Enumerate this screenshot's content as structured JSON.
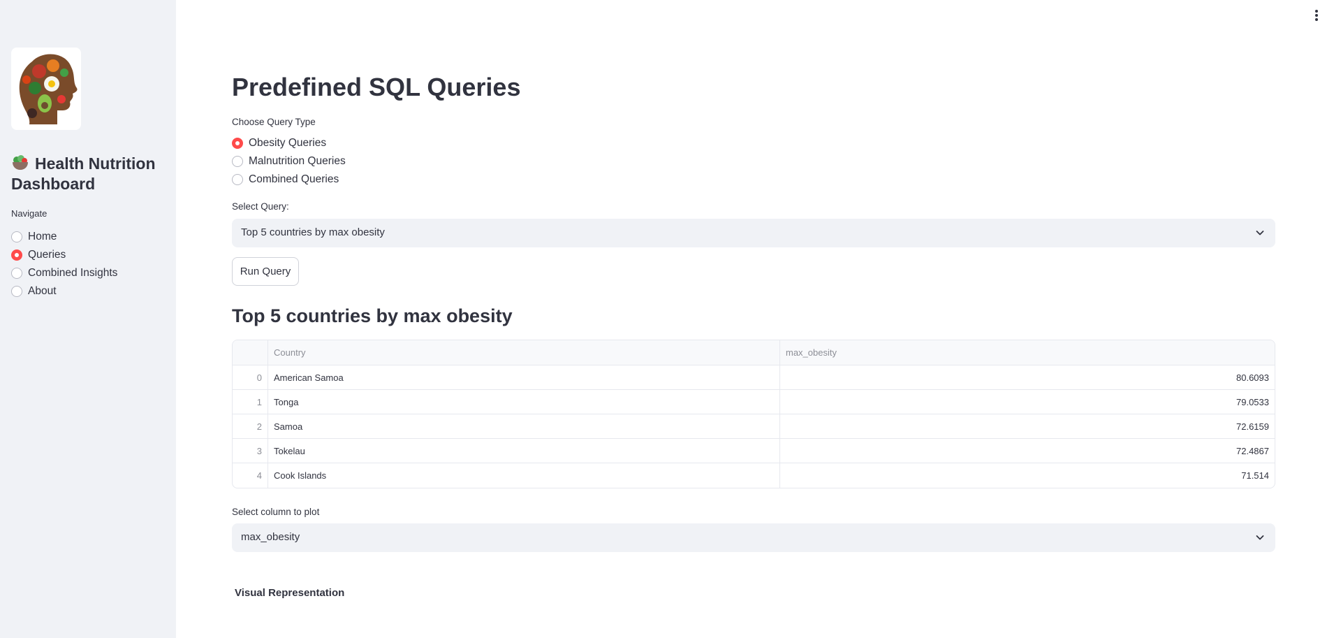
{
  "sidebar": {
    "title": "Health Nutrition Dashboard",
    "nav_label": "Navigate",
    "nav_items": [
      {
        "label": "Home",
        "selected": false
      },
      {
        "label": "Queries",
        "selected": true
      },
      {
        "label": "Combined Insights",
        "selected": false
      },
      {
        "label": "About",
        "selected": false
      }
    ]
  },
  "main": {
    "page_title": "Predefined SQL Queries",
    "query_type": {
      "label": "Choose Query Type",
      "options": [
        {
          "label": "Obesity Queries",
          "selected": true
        },
        {
          "label": "Malnutrition Queries",
          "selected": false
        },
        {
          "label": "Combined Queries",
          "selected": false
        }
      ]
    },
    "select_query": {
      "label": "Select Query:",
      "value": "Top 5 countries by max obesity"
    },
    "run_button": "Run Query",
    "result_title": "Top 5 countries by max obesity",
    "table": {
      "columns": [
        "Country",
        "max_obesity"
      ],
      "rows": [
        {
          "index": "0",
          "country": "American Samoa",
          "max_obesity": "80.6093"
        },
        {
          "index": "1",
          "country": "Tonga",
          "max_obesity": "79.0533"
        },
        {
          "index": "2",
          "country": "Samoa",
          "max_obesity": "72.6159"
        },
        {
          "index": "3",
          "country": "Tokelau",
          "max_obesity": "72.4867"
        },
        {
          "index": "4",
          "country": "Cook Islands",
          "max_obesity": "71.514"
        }
      ]
    },
    "plot_column": {
      "label": "Select column to plot",
      "value": "max_obesity"
    },
    "visual_label": "Visual Representation"
  },
  "colors": {
    "accent": "#ff4b4b",
    "sidebar_bg": "#f0f2f6",
    "text": "#31333f"
  }
}
